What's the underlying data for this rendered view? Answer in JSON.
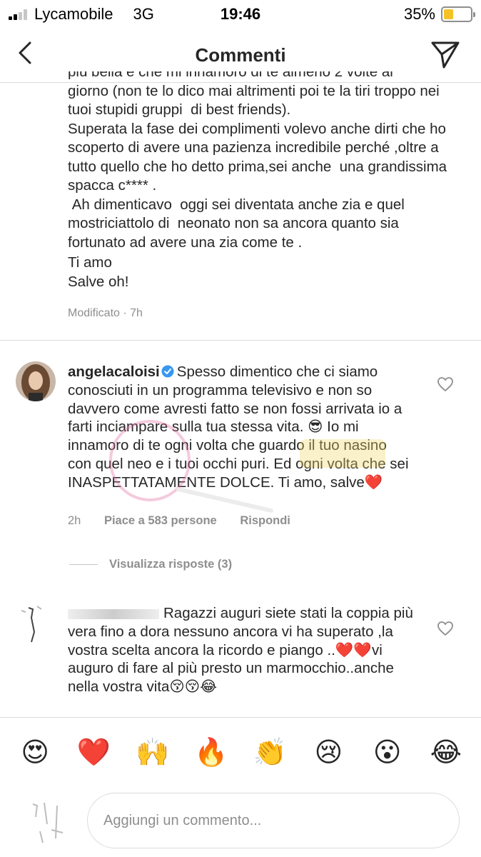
{
  "status_bar": {
    "carrier": "Lycamobile",
    "network": "3G",
    "time": "19:46",
    "battery_text": "35%",
    "battery_level": 0.35
  },
  "header": {
    "title": "Commenti"
  },
  "caption": {
    "cut_line": "più bella e che mi innamoro di te almeno 2 volte al",
    "paragraphs": [
      "giorno (non te lo dico mai altrimenti poi te la tiri troppo nei tuoi stupidi gruppi  di best friends).",
      "Superata la fase dei complimenti volevo anche dirti che ho scoperto di avere una pazienza incredibile perché ,oltre a tutto quello che ho detto prima,sei anche  una grandissima spacca c**** .",
      " Ah dimenticavo  oggi sei diventata anche zia e quel mostriciattolo di  neonato non sa ancora quanto sia fortunato ad avere una zia come te .",
      "Ti amo",
      "Salve oh!"
    ],
    "meta": "Modificato · 7h"
  },
  "comments": [
    {
      "username": "angelacaloisi",
      "text": "Spesso dimentico che ci siamo conosciuti in un programma televisivo e non so davvero come avresti fatto se non fossi arrivata io a farti inciampare sulla tua stessa vita. 😎 Io mi innamoro di te ogni volta che guardo il tuo nasino con quel neo e i tuoi occhi puri. Ed ogni volta che sei INASPETTATAMENTE DOLCE. Ti amo, salve❤️",
      "time": "2h",
      "likes": "Piace a 583 persone",
      "reply": "Rispondi",
      "view_replies": "Visualizza risposte (3)"
    },
    {
      "username": "",
      "text": "Ragazzi auguri siete stati la coppia più vera fino a dora nessuno ancora vi ha superato ,la vostra scelta ancora la ricordo e piango ..❤️❤️vi auguro di fare al più presto un marmocchio..anche nella vostra vita😚😚😂"
    }
  ],
  "emoji_bar": [
    "😍",
    "❤️",
    "🙌",
    "🔥",
    "👏",
    "😢",
    "😮",
    "😂"
  ],
  "input": {
    "placeholder": "Aggiungi un commento..."
  },
  "colors": {
    "text": "#262626",
    "secondary": "#8e8e8e",
    "divider": "#dbdbdb",
    "verified": "#3897f0",
    "battery": "#f5c226"
  }
}
